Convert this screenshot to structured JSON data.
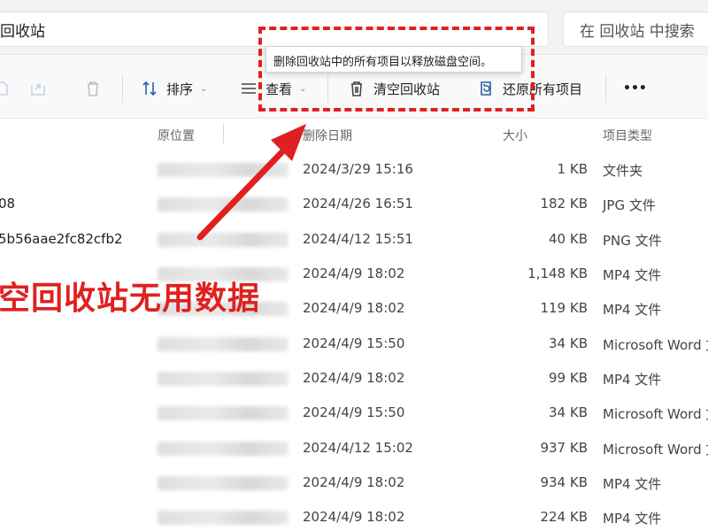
{
  "address": {
    "path": "回收站"
  },
  "search": {
    "placeholder": "在 回收站 中搜索"
  },
  "toolbar": {
    "sort_label": "排序",
    "view_label": "查看",
    "empty_label": "清空回收站",
    "restore_label": "还原所有项目",
    "more_label": "•••"
  },
  "tooltip": {
    "text": "删除回收站中的所有项目以释放磁盘空间。"
  },
  "columns": {
    "original_location": "原位置",
    "deleted_date": "删除日期",
    "size": "大小",
    "type": "项目类型"
  },
  "rows": [
    {
      "name": "",
      "date": "2024/3/29 15:16",
      "size": "1 KB",
      "type": "文件夹"
    },
    {
      "name": "08",
      "date": "2024/4/26 16:51",
      "size": "182 KB",
      "type": "JPG 文件"
    },
    {
      "name": "5b56aae2fc82cfb2",
      "date": "2024/4/12 15:51",
      "size": "40 KB",
      "type": "PNG 文件"
    },
    {
      "name": "",
      "date": "2024/4/9 18:02",
      "size": "1,148 KB",
      "type": "MP4 文件"
    },
    {
      "name": "",
      "date": "2024/4/9 18:02",
      "size": "119 KB",
      "type": "MP4 文件"
    },
    {
      "name": "",
      "date": "2024/4/9 15:50",
      "size": "34 KB",
      "type": "Microsoft Word 文"
    },
    {
      "name": "",
      "date": "2024/4/9 18:02",
      "size": "99 KB",
      "type": "MP4 文件"
    },
    {
      "name": "",
      "date": "2024/4/9 15:50",
      "size": "34 KB",
      "type": "Microsoft Word 文"
    },
    {
      "name": "",
      "date": "2024/4/12 15:02",
      "size": "937 KB",
      "type": "Microsoft Word 文"
    },
    {
      "name": "",
      "date": "2024/4/9 18:02",
      "size": "934 KB",
      "type": "MP4 文件"
    },
    {
      "name": "",
      "date": "2024/4/9 18:02",
      "size": "224 KB",
      "type": "MP4 文件"
    }
  ],
  "annotation": {
    "caption": "空回收站无用数据",
    "color": "#e02020"
  },
  "icons": {
    "new": "new-item-icon",
    "share": "share-icon",
    "delete": "trash-icon",
    "sort": "sort-arrows-icon",
    "view": "view-lines-icon",
    "empty": "trash-icon",
    "restore": "restore-icon"
  }
}
